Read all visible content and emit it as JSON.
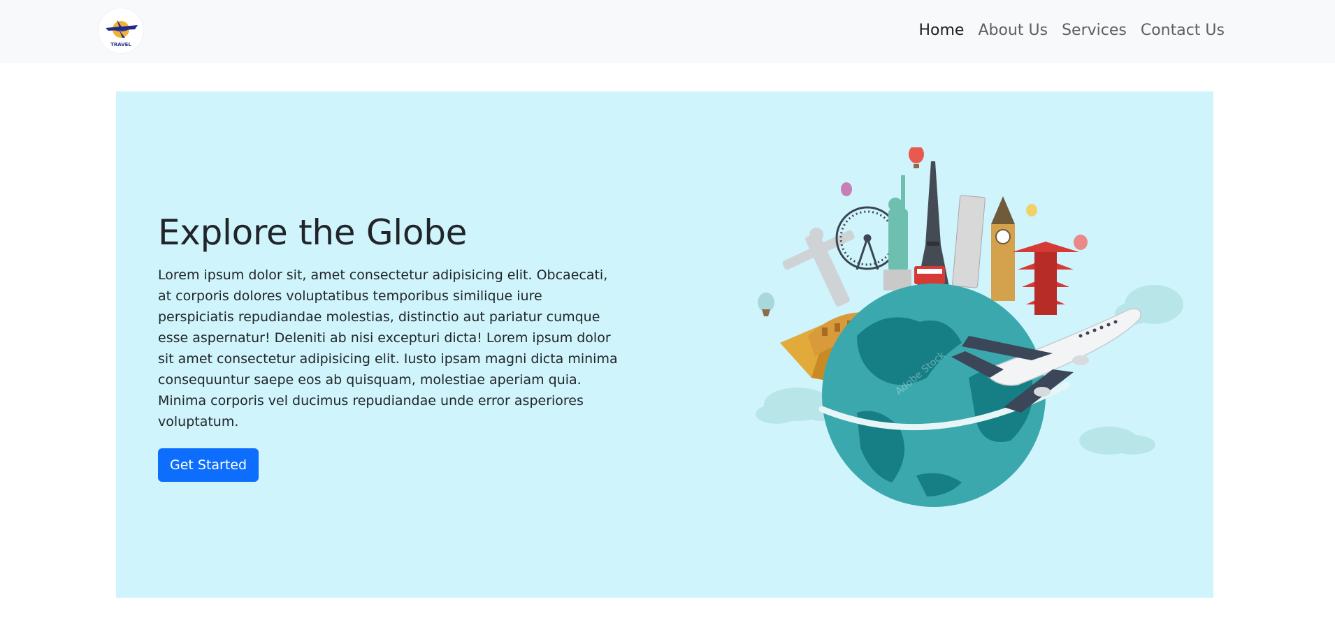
{
  "brand": {
    "logo_icon": "travel-globe-plane-logo",
    "logo_text": "TRAVEL"
  },
  "nav": {
    "items": [
      {
        "label": "Home",
        "active": true
      },
      {
        "label": "About Us",
        "active": false
      },
      {
        "label": "Services",
        "active": false
      },
      {
        "label": "Contact Us",
        "active": false
      }
    ]
  },
  "hero": {
    "title": "Explore the Globe",
    "body": "Lorem ipsum dolor sit, amet consectetur adipisicing elit. Obcaecati, at corporis dolores voluptatibus temporibus similique iure perspiciatis repudiandae molestias, distinctio aut pariatur cumque esse aspernatur! Deleniti ab nisi excepturi dicta! Lorem ipsum dolor sit amet consectetur adipisicing elit. Iusto ipsam magni dicta minima consequuntur saepe eos ab quisquam, molestiae aperiam quia. Minima corporis vel ducimus repudiandae unde error asperiores voluptatum.",
    "cta_label": "Get Started",
    "illustration_icon": "globe-landmarks-airplane-illustration",
    "watermark": "Adobe Stock"
  },
  "colors": {
    "navbar_bg": "#f8f9fa",
    "hero_bg": "#cff4fc",
    "primary": "#0d6efd",
    "globe_ocean": "#3aa8ad",
    "globe_land": "#167f86"
  }
}
